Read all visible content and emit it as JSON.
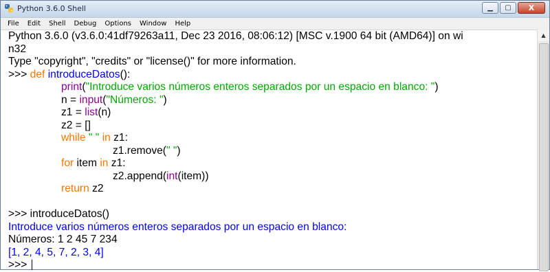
{
  "window": {
    "title": "Python 3.6.0 Shell",
    "controls": {
      "minimize": "▁",
      "maximize": "▢",
      "close": "X"
    }
  },
  "menu": [
    "File",
    "Edit",
    "Shell",
    "Debug",
    "Options",
    "Window",
    "Help"
  ],
  "colors": {
    "keyword": "#ff7700",
    "builtin": "#900090",
    "string": "#00aa00",
    "defname": "#0000ff",
    "stdout": "#0000ff",
    "prompt": "#000000",
    "default": "#000000"
  },
  "shell_lines": [
    [
      {
        "t": "Python 3.6.0 (v3.6.0:41df79263a11, Dec 23 2016, 08:06:12) [MSC v.1900 64 bit (AMD64)] on wi",
        "c": "default"
      }
    ],
    [
      {
        "t": "n32",
        "c": "default"
      }
    ],
    [
      {
        "t": "Type \"copyright\", \"credits\" or \"license()\" for more information.",
        "c": "default"
      }
    ],
    [
      {
        "t": ">>> ",
        "c": "prompt"
      },
      {
        "t": "def",
        "c": "keyword"
      },
      {
        "t": " ",
        "c": "default"
      },
      {
        "t": "introduceDatos",
        "c": "defname"
      },
      {
        "t": "():",
        "c": "default"
      }
    ],
    [
      {
        "t": "print",
        "c": "builtin",
        "indent": 1
      },
      {
        "t": "(",
        "c": "default"
      },
      {
        "t": "\"Introduce varios números enteros separados por un espacio en blanco: \"",
        "c": "string"
      },
      {
        "t": ")",
        "c": "default"
      }
    ],
    [
      {
        "t": "n = ",
        "c": "default",
        "indent": 1
      },
      {
        "t": "input",
        "c": "builtin"
      },
      {
        "t": "(",
        "c": "default"
      },
      {
        "t": "\"Números: \"",
        "c": "string"
      },
      {
        "t": ")",
        "c": "default"
      }
    ],
    [
      {
        "t": "z1 = ",
        "c": "default",
        "indent": 1
      },
      {
        "t": "list",
        "c": "builtin"
      },
      {
        "t": "(n)",
        "c": "default"
      }
    ],
    [
      {
        "t": "z2 = []",
        "c": "default",
        "indent": 1
      }
    ],
    [
      {
        "t": "while",
        "c": "keyword",
        "indent": 1
      },
      {
        "t": " ",
        "c": "default"
      },
      {
        "t": "\" \"",
        "c": "string"
      },
      {
        "t": " ",
        "c": "default"
      },
      {
        "t": "in",
        "c": "keyword"
      },
      {
        "t": " z1:",
        "c": "default"
      }
    ],
    [
      {
        "t": "z1.remove(",
        "c": "default",
        "indent": 2
      },
      {
        "t": "\" \"",
        "c": "string"
      },
      {
        "t": ")",
        "c": "default"
      }
    ],
    [
      {
        "t": "for",
        "c": "keyword",
        "indent": 1
      },
      {
        "t": " item ",
        "c": "default"
      },
      {
        "t": "in",
        "c": "keyword"
      },
      {
        "t": " z1:",
        "c": "default"
      }
    ],
    [
      {
        "t": "z2.append(",
        "c": "default",
        "indent": 2
      },
      {
        "t": "int",
        "c": "builtin"
      },
      {
        "t": "(item))",
        "c": "default"
      }
    ],
    [
      {
        "t": "return",
        "c": "keyword",
        "indent": 1
      },
      {
        "t": " z2",
        "c": "default"
      }
    ],
    [],
    [
      {
        "t": ">>> introduceDatos()",
        "c": "default"
      }
    ],
    [
      {
        "t": "Introduce varios números enteros separados por un espacio en blanco:",
        "c": "stdout"
      }
    ],
    [
      {
        "t": "Números: 1 2 45 7 234",
        "c": "default"
      }
    ],
    [
      {
        "t": "[1, 2, 4, 5, 7, 2, 3, 4]",
        "c": "stdout"
      }
    ],
    [
      {
        "t": ">>> ",
        "c": "prompt",
        "cursor": true
      }
    ]
  ]
}
